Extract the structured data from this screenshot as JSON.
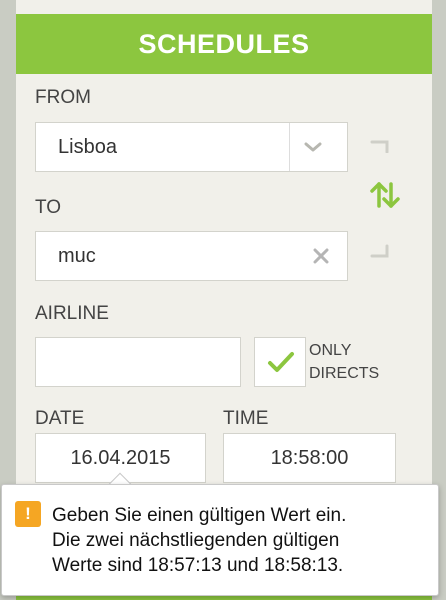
{
  "header": {
    "title": "SCHEDULES"
  },
  "from": {
    "label": "FROM",
    "value": "Lisboa"
  },
  "to": {
    "label": "TO",
    "value": "muc"
  },
  "airline": {
    "label": "AIRLINE",
    "value": ""
  },
  "directs": {
    "label_line1": "ONLY",
    "label_line2": "DIRECTS",
    "checked": true
  },
  "date": {
    "label": "DATE",
    "value": "16.04.2015"
  },
  "time": {
    "label": "TIME",
    "value": "18:58:00"
  },
  "tooltip": {
    "icon": "!",
    "line1": "Geben Sie einen gültigen Wert ein.",
    "line2": "Die zwei nächstliegenden gültigen",
    "line3": "Werte sind 18:57:13 und 18:58:13."
  },
  "colors": {
    "accent": "#8cc63f",
    "warning": "#f5a623",
    "panel": "#f1f0ea"
  },
  "icons": {
    "from_dropdown": "chevron-down-icon",
    "to_clear": "close-icon",
    "swap": "swap-arrows-icon",
    "check": "checkmark-icon",
    "warn": "warning-icon"
  }
}
